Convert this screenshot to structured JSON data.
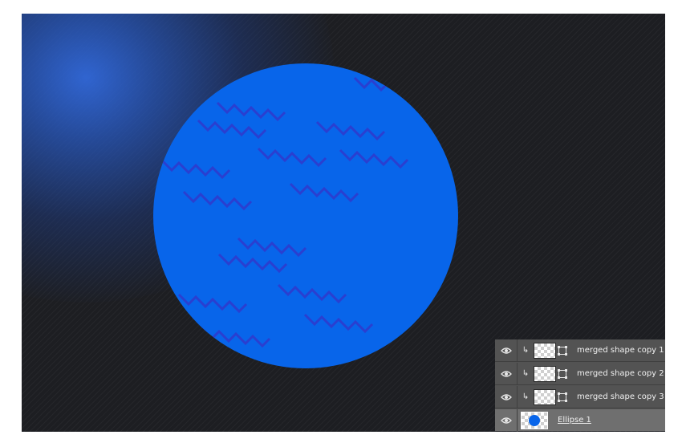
{
  "canvas": {
    "background_color": "#1d1e22",
    "glow_color": "#3168d9",
    "circle_color": "#0865ea",
    "zigzag_color": "#2a3fd0"
  },
  "layers_panel": {
    "layers": [
      {
        "name": "merged shape copy 1",
        "visible": true,
        "clipped": true,
        "selected": false,
        "thumbnail": "transparent-with-shape"
      },
      {
        "name": "merged shape copy 2",
        "visible": true,
        "clipped": true,
        "selected": false,
        "thumbnail": "transparent-with-shape"
      },
      {
        "name": "merged shape copy 3",
        "visible": true,
        "clipped": true,
        "selected": false,
        "thumbnail": "transparent-with-shape"
      },
      {
        "name": "Ellipse 1",
        "visible": true,
        "clipped": false,
        "selected": true,
        "thumbnail": "blue-circle"
      }
    ],
    "eye_icon": "eye-icon",
    "clip_icon": "clipping-arrow-icon",
    "mask_icon": "vector-mask-icon"
  }
}
